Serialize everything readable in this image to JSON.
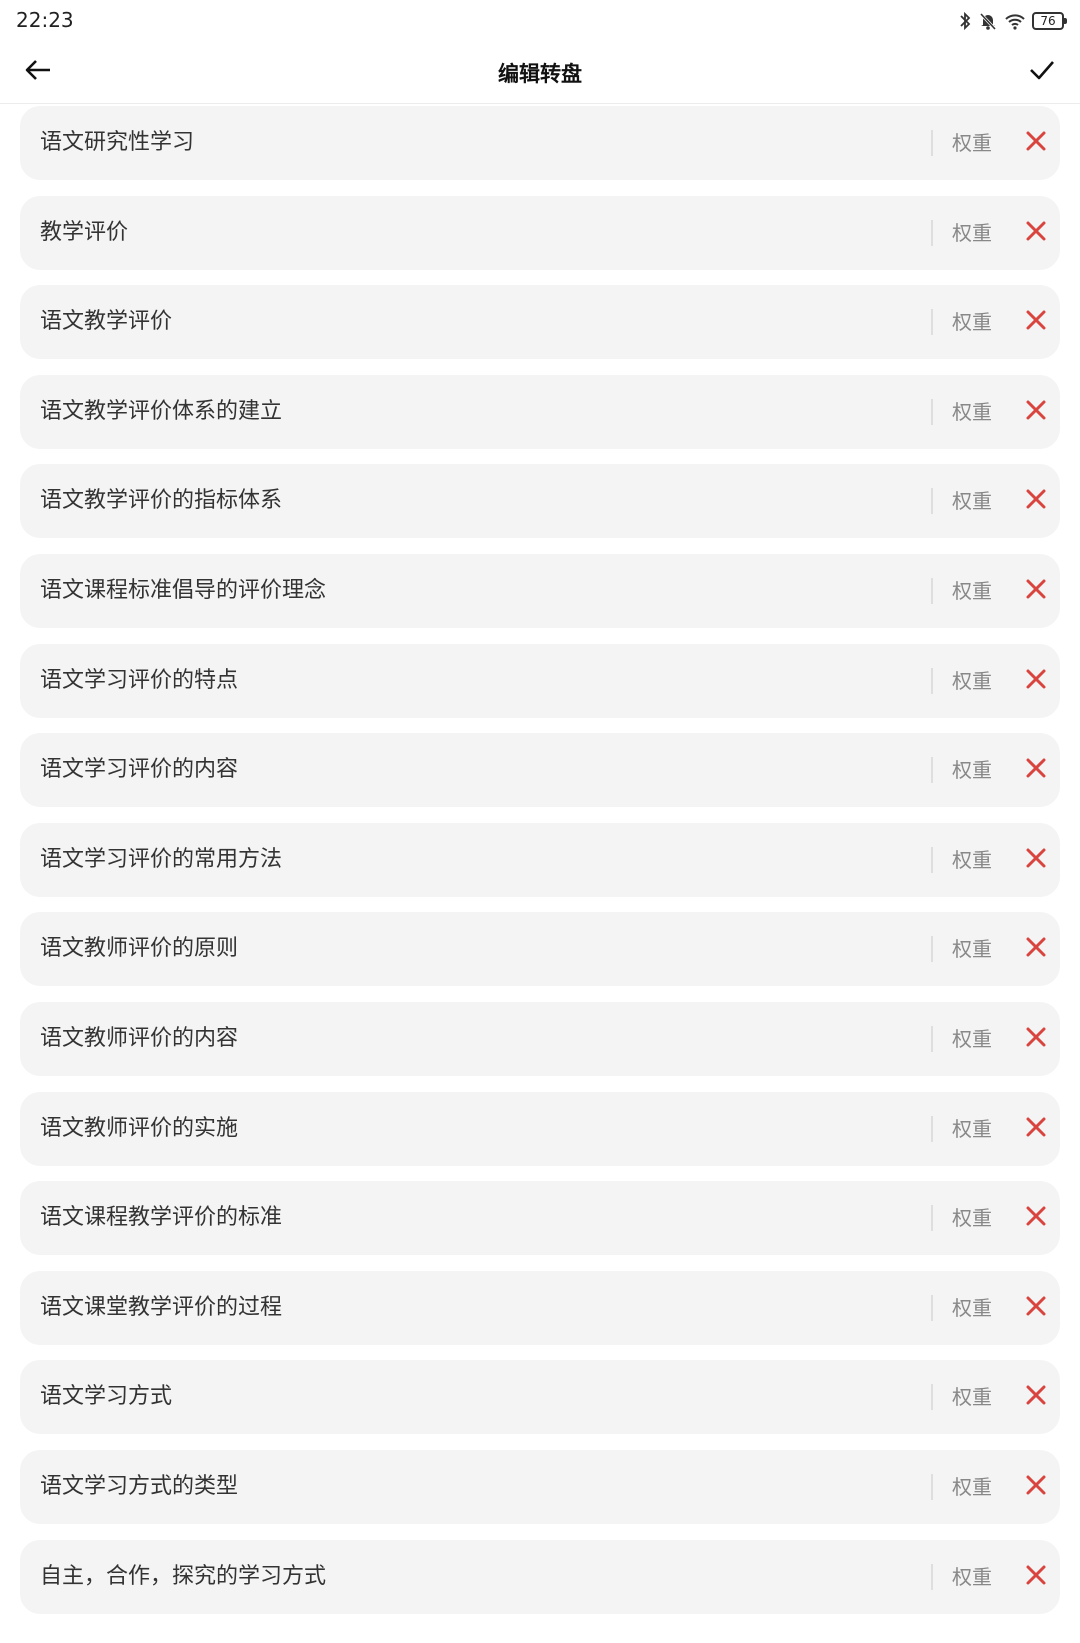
{
  "status_bar": {
    "time": "22:23",
    "battery": "76",
    "icons": [
      "bluetooth-icon",
      "bell-muted-icon",
      "wifi-icon",
      "battery-icon"
    ]
  },
  "header": {
    "title": "编辑转盘",
    "back_icon": "arrow-left-icon",
    "confirm_icon": "checkmark-icon"
  },
  "colors": {
    "item_background": "#f4f4f4",
    "delete_accent": "#d9443f",
    "weight_text": "#888888"
  },
  "items": [
    {
      "label": "语文研究性学习",
      "weight_label": "权重"
    },
    {
      "label": "教学评价",
      "weight_label": "权重"
    },
    {
      "label": "语文教学评价",
      "weight_label": "权重"
    },
    {
      "label": "语文教学评价体系的建立",
      "weight_label": "权重"
    },
    {
      "label": "语文教学评价的指标体系",
      "weight_label": "权重"
    },
    {
      "label": "语文课程标准倡导的评价理念",
      "weight_label": "权重"
    },
    {
      "label": "语文学习评价的特点",
      "weight_label": "权重"
    },
    {
      "label": "语文学习评价的内容",
      "weight_label": "权重"
    },
    {
      "label": "语文学习评价的常用方法",
      "weight_label": "权重"
    },
    {
      "label": "语文教师评价的原则",
      "weight_label": "权重"
    },
    {
      "label": "语文教师评价的内容",
      "weight_label": "权重"
    },
    {
      "label": "语文教师评价的实施",
      "weight_label": "权重"
    },
    {
      "label": "语文课程教学评价的标准",
      "weight_label": "权重"
    },
    {
      "label": "语文课堂教学评价的过程",
      "weight_label": "权重"
    },
    {
      "label": "语文学习方式",
      "weight_label": "权重"
    },
    {
      "label": "语文学习方式的类型",
      "weight_label": "权重"
    },
    {
      "label": "自主，合作，探究的学习方式",
      "weight_label": "权重"
    }
  ]
}
